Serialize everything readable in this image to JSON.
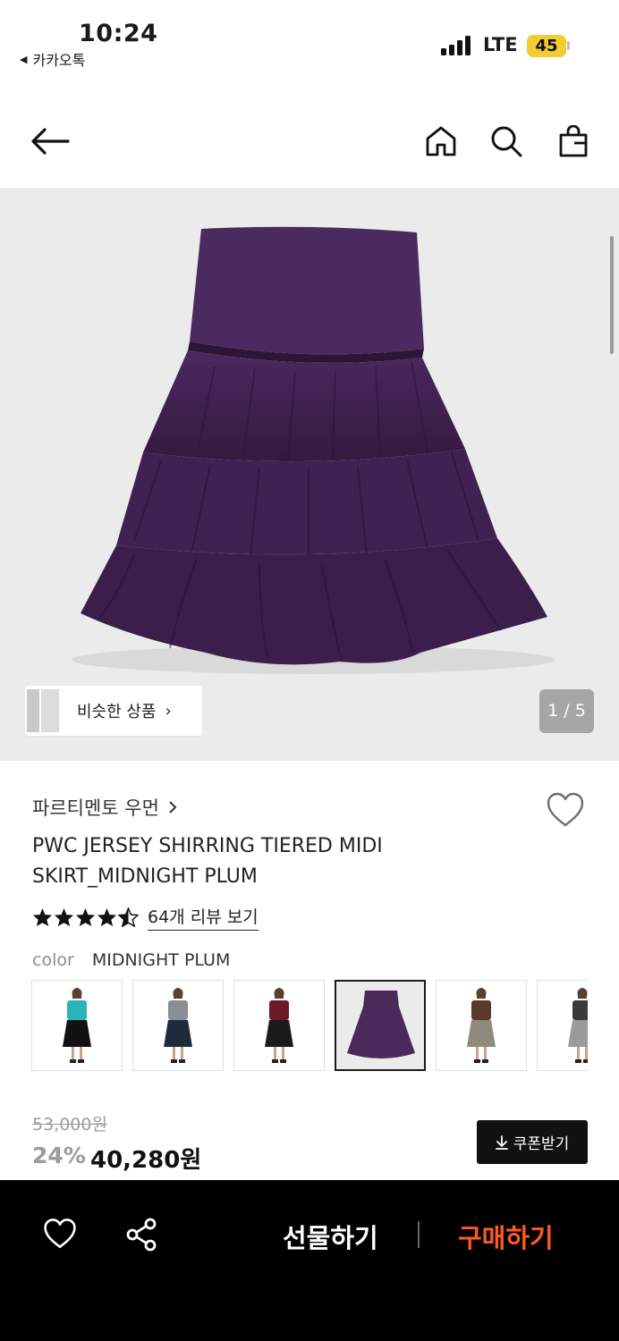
{
  "status_bar": {
    "time": "10:24",
    "back_app": "카카오톡",
    "network": "LTE",
    "battery": "45"
  },
  "navbar": {
    "icons": [
      "back-arrow-icon",
      "home-icon",
      "search-icon",
      "shopping-bag-icon"
    ]
  },
  "gallery": {
    "similar_label": "비슷한 상품",
    "counter": "1 / 5"
  },
  "product": {
    "brand": "파르티멘토 우먼",
    "title": "PWC JERSEY SHIRRING TIERED MIDI SKIRT_MIDNIGHT PLUM",
    "rating": 4.5,
    "review_link": "64개 리뷰 보기",
    "color_label": "color",
    "color_value": "MIDNIGHT PLUM"
  },
  "color_options": [
    {
      "top": "#2ab3b8",
      "bottom": "#111111",
      "selected": false
    },
    {
      "top": "#8a8f94",
      "bottom": "#1f2a3d",
      "selected": false
    },
    {
      "top": "#6b1a2a",
      "bottom": "#1a1a1a",
      "selected": false
    },
    {
      "top": "#4a2a5a",
      "bottom": "#4a2a5a",
      "selected": true
    },
    {
      "top": "#5a3a2a",
      "bottom": "#8e8a7e",
      "selected": false
    },
    {
      "top": "#3a3a3a",
      "bottom": "#9a9a9a",
      "selected": false
    }
  ],
  "price": {
    "original": "53,000원",
    "discount": "24%",
    "final": "40,280원",
    "coupon_label": "쿠폰받기"
  },
  "bottom_bar": {
    "gift_label": "선물하기",
    "buy_label": "구매하기",
    "buy_color": "#ff5a1f"
  },
  "colors": {
    "skirt": "#3d2150",
    "hero_bg": "#ebebeb"
  }
}
